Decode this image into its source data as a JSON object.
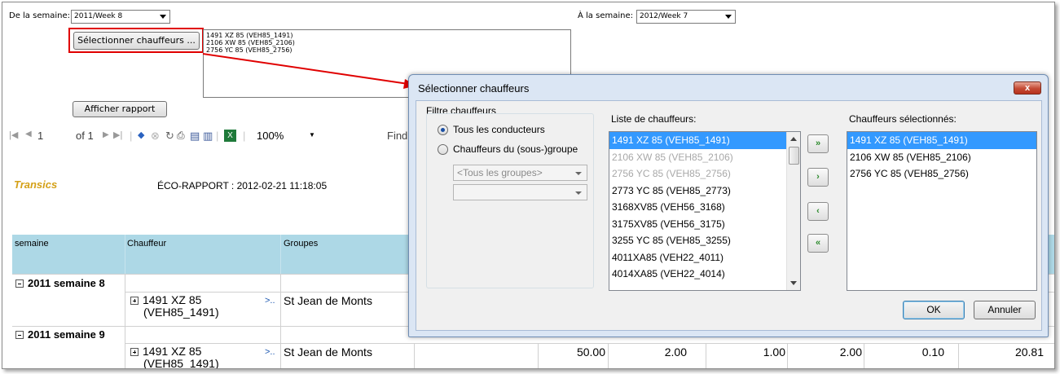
{
  "filters": {
    "from_label": "De la semaine:",
    "from_value": "2011/Week 8",
    "to_label": "À la semaine:",
    "to_value": "2012/Week 7",
    "select_drivers_button": "Sélectionner chauffeurs ...",
    "selected_drivers": [
      "1491 XZ 85  (VEH85_1491)",
      "2106 XW 85  (VEH85_2106)",
      "2756 YC 85  (VEH85_2756)"
    ],
    "show_report_button": "Afficher rapport"
  },
  "toolbar": {
    "page_current": "1",
    "page_of": "of 1",
    "zoom": "100%",
    "find_label": "Find"
  },
  "report": {
    "brand": "Transics",
    "title": "ÉCO-RAPPORT : 2012-02-21 11:18:05",
    "columns": [
      "semaine",
      "Chauffeur",
      "Groupes"
    ],
    "groups": [
      {
        "week": "2011 semaine 8",
        "rows": [
          {
            "driver_line1": "1491 XZ 85",
            "driver_line2": "(VEH85_1491)",
            "link": ">..",
            "group": "St Jean de Monts"
          }
        ]
      },
      {
        "week": "2011 semaine 9",
        "rows": [
          {
            "driver_line1": "1491 XZ 85",
            "driver_line2": "(VEH85_1491)",
            "link": ">..",
            "group": "St Jean de Monts",
            "values": [
              "50.00",
              "2.00",
              "1.00",
              "2.00",
              "0.10",
              "20.81"
            ]
          }
        ]
      }
    ]
  },
  "dialog": {
    "title": "Sélectionner chauffeurs",
    "close_label": "x",
    "filter_group_title": "Filtre chauffeurs",
    "radio_all": "Tous les conducteurs",
    "radio_group": "Chauffeurs du (sous-)groupe",
    "group_select_value": "<Tous les groupes>",
    "subgroup_select_value": "",
    "available_title": "Liste de chauffeurs:",
    "available": [
      {
        "label": "1491 XZ 85  (VEH85_1491)",
        "state": "selected"
      },
      {
        "label": "2106 XW 85  (VEH85_2106)",
        "state": "dim"
      },
      {
        "label": "2756 YC 85  (VEH85_2756)",
        "state": "dim"
      },
      {
        "label": "2773 YC 85  (VEH85_2773)",
        "state": "normal"
      },
      {
        "label": "3168XV85  (VEH56_3168)",
        "state": "normal"
      },
      {
        "label": "3175XV85  (VEH56_3175)",
        "state": "normal"
      },
      {
        "label": "3255 YC 85  (VEH85_3255)",
        "state": "normal"
      },
      {
        "label": "4011XA85  (VEH22_4011)",
        "state": "normal"
      },
      {
        "label": "4014XA85  (VEH22_4014)",
        "state": "normal"
      }
    ],
    "selected_title": "Chauffeurs sélectionnés:",
    "selected": [
      {
        "label": "1491 XZ 85  (VEH85_1491)",
        "state": "selected"
      },
      {
        "label": "2106 XW 85  (VEH85_2106)",
        "state": "normal"
      },
      {
        "label": "2756 YC 85  (VEH85_2756)",
        "state": "normal"
      }
    ],
    "move_buttons": [
      "»",
      "›",
      "‹",
      "«"
    ],
    "ok_label": "OK",
    "cancel_label": "Annuler"
  },
  "colors": {
    "header_bg": "#add8e6",
    "brand": "#d4a017",
    "highlight": "#e00000",
    "selection": "#3399ff"
  }
}
